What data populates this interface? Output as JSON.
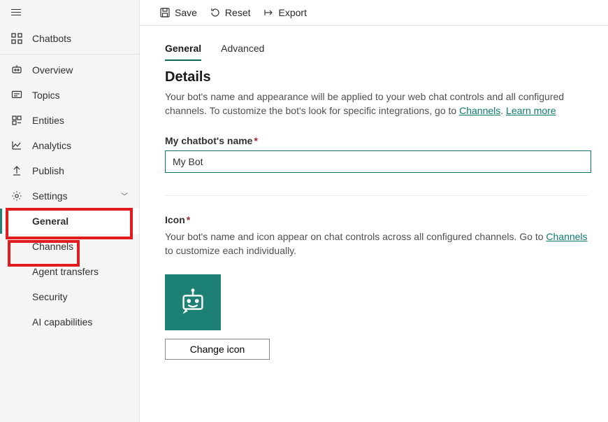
{
  "sidebar": {
    "top": {
      "label": "Chatbots"
    },
    "items": [
      {
        "label": "Overview"
      },
      {
        "label": "Topics"
      },
      {
        "label": "Entities"
      },
      {
        "label": "Analytics"
      },
      {
        "label": "Publish"
      },
      {
        "label": "Settings"
      }
    ],
    "settings_children": [
      {
        "label": "General"
      },
      {
        "label": "Channels"
      },
      {
        "label": "Agent transfers"
      },
      {
        "label": "Security"
      },
      {
        "label": "AI capabilities"
      }
    ]
  },
  "toolbar": {
    "save": "Save",
    "reset": "Reset",
    "export": "Export"
  },
  "tabs": {
    "general": "General",
    "advanced": "Advanced"
  },
  "details": {
    "heading": "Details",
    "description_pre": "Your bot's name and appearance will be applied to your web chat controls and all configured channels. To customize the bot's look for specific integrations, go to ",
    "description_link1": "Channels",
    "description_sep": ". ",
    "description_link2": "Learn more",
    "name_label": "My chatbot's name",
    "name_value": "My Bot"
  },
  "icon_section": {
    "label": "Icon",
    "description_pre": "Your bot's name and icon appear on chat controls across all configured channels. Go to ",
    "description_link": "Channels",
    "description_post": " to customize each individually.",
    "change_btn": "Change icon"
  }
}
